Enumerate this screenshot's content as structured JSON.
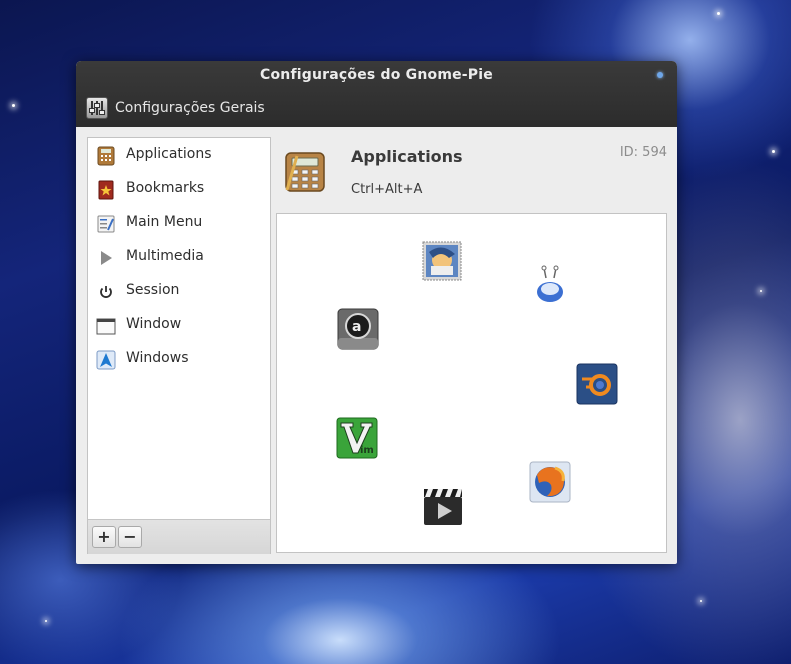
{
  "window": {
    "title": "Configurações do Gnome-Pie"
  },
  "toolbar": {
    "general_settings_label": "Configurações Gerais",
    "icon": "settings-sliders-icon"
  },
  "pies": [
    {
      "label": "Applications",
      "icon": "calculator-icon"
    },
    {
      "label": "Bookmarks",
      "icon": "bookmark-star-icon"
    },
    {
      "label": "Main Menu",
      "icon": "main-menu-icon"
    },
    {
      "label": "Multimedia",
      "icon": "play-triangle-icon"
    },
    {
      "label": "Session",
      "icon": "power-icon"
    },
    {
      "label": "Window",
      "icon": "window-icon"
    },
    {
      "label": "Windows",
      "icon": "arch-logo-icon"
    }
  ],
  "list_controls": {
    "add_label": "+",
    "remove_label": "−"
  },
  "selected_pie": {
    "name": "Applications",
    "shortcut": "Ctrl+Alt+A",
    "id_text": "ID: 594",
    "icon": "calculator-icon"
  },
  "slices": [
    {
      "name": "thunderbird",
      "icon": "thunderbird-icon"
    },
    {
      "name": "empathy",
      "icon": "empathy-icon"
    },
    {
      "name": "blender",
      "icon": "blender-icon"
    },
    {
      "name": "firefox",
      "icon": "firefox-icon"
    },
    {
      "name": "movie-player",
      "icon": "clapperboard-icon"
    },
    {
      "name": "vim",
      "icon": "vim-icon"
    },
    {
      "name": "amarok",
      "icon": "amarok-icon"
    }
  ],
  "colors": {
    "titlebar": "#2f2f2f",
    "window_bg": "#ededed",
    "accent": "#6ea6e8"
  }
}
